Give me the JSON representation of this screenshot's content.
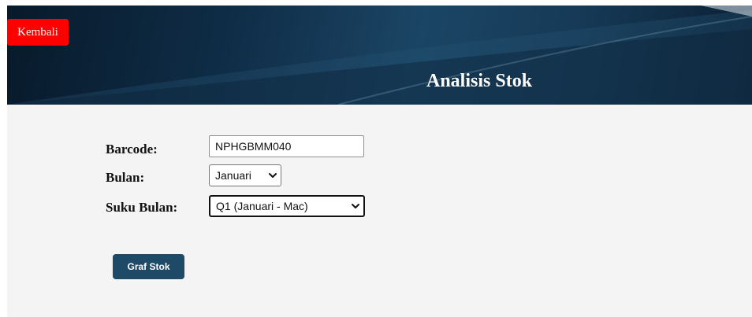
{
  "header": {
    "back_label": "Kembali",
    "title": "Analisis Stok",
    "banner_colors": [
      "#081a2b",
      "#1b4565",
      "#0a1f33"
    ]
  },
  "form": {
    "barcode": {
      "label": "Barcode:",
      "value": "NPHGBMM040"
    },
    "month": {
      "label": "Bulan:",
      "selected": "Januari"
    },
    "quarter": {
      "label": "Suku Bulan:",
      "selected": "Q1 (Januari - Mac)"
    },
    "submit_label": "Graf Stok"
  },
  "colors": {
    "back_button": "#ff0000",
    "submit_button": "#1e4a68",
    "page_background": "#f4f4f4"
  }
}
